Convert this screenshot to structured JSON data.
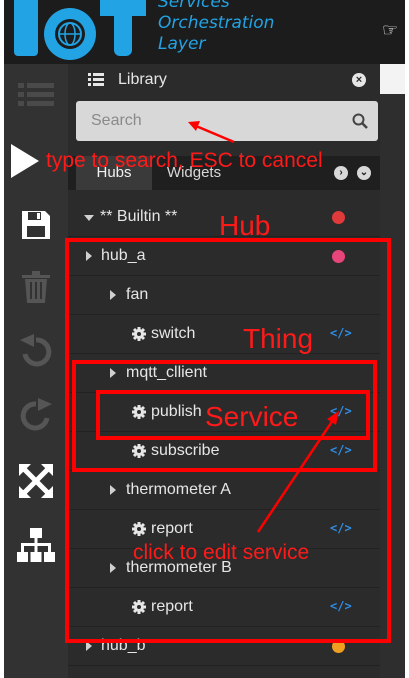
{
  "header": {
    "tagline": [
      "Services",
      "Orchestration",
      "Layer"
    ],
    "hand_icon": "pointing-hand-icon"
  },
  "toolbar": {
    "buttons": [
      "list-icon",
      "play-icon",
      "save-icon",
      "trash-icon",
      "undo-icon",
      "redo-icon",
      "fullscreen-icon",
      "hierarchy-icon"
    ]
  },
  "library": {
    "title": "Library",
    "search_placeholder": "Search",
    "tabs": {
      "hubs": "Hubs",
      "widgets": "Widgets"
    },
    "tree": {
      "builtin": "** Builtin **",
      "hub_a": "hub_a",
      "fan": "fan",
      "switch": "switch",
      "mqtt_client": "mqtt_cllient",
      "publish": "publish",
      "subscribe": "subscribe",
      "thermometer_a": "thermometer A",
      "report_a": "report",
      "thermometer_b": "thermometer B",
      "report_b": "report",
      "hub_b": "hub_b"
    },
    "status_colors": {
      "builtin": "#e03a3a",
      "hub_a": "#e8457a",
      "hub_b": "#f0a020"
    }
  },
  "annotations": {
    "search_hint": "type to search, ESC to cancel",
    "hub": "Hub",
    "thing": "Thing",
    "service": "Service",
    "edit_hint": "click to edit service"
  }
}
